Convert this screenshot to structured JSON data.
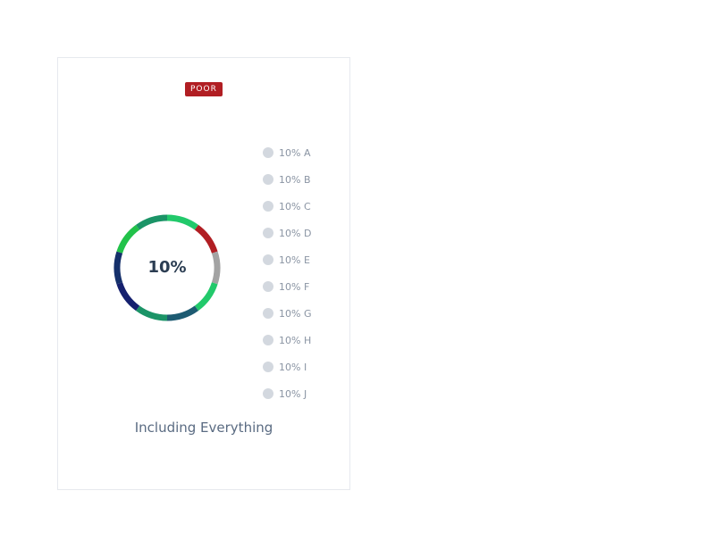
{
  "card": {
    "badge": "POOR",
    "badge_color": "#b11e23",
    "caption": "Including Everything"
  },
  "chart_data": {
    "type": "pie",
    "variant": "donut",
    "center_label": "10%",
    "series": [
      {
        "label": "10% A",
        "value": 10,
        "color": "#22c96b"
      },
      {
        "label": "10% B",
        "value": 10,
        "color": "#b11e23"
      },
      {
        "label": "10% C",
        "value": 10,
        "color": "#a3a3a3"
      },
      {
        "label": "10% D",
        "value": 10,
        "color": "#22c96b"
      },
      {
        "label": "10% E",
        "value": 10,
        "color": "#1d5b72"
      },
      {
        "label": "10% F",
        "value": 10,
        "color": "#1b9467"
      },
      {
        "label": "10% G",
        "value": 10,
        "color": "#15206e"
      },
      {
        "label": "10% H",
        "value": 10,
        "color": "#15306b"
      },
      {
        "label": "10% I",
        "value": 10,
        "color": "#22c24a"
      },
      {
        "label": "10% J",
        "value": 10,
        "color": "#1b9467"
      }
    ],
    "legend_position": "right",
    "legend_marker_color": "#d3d8df"
  }
}
